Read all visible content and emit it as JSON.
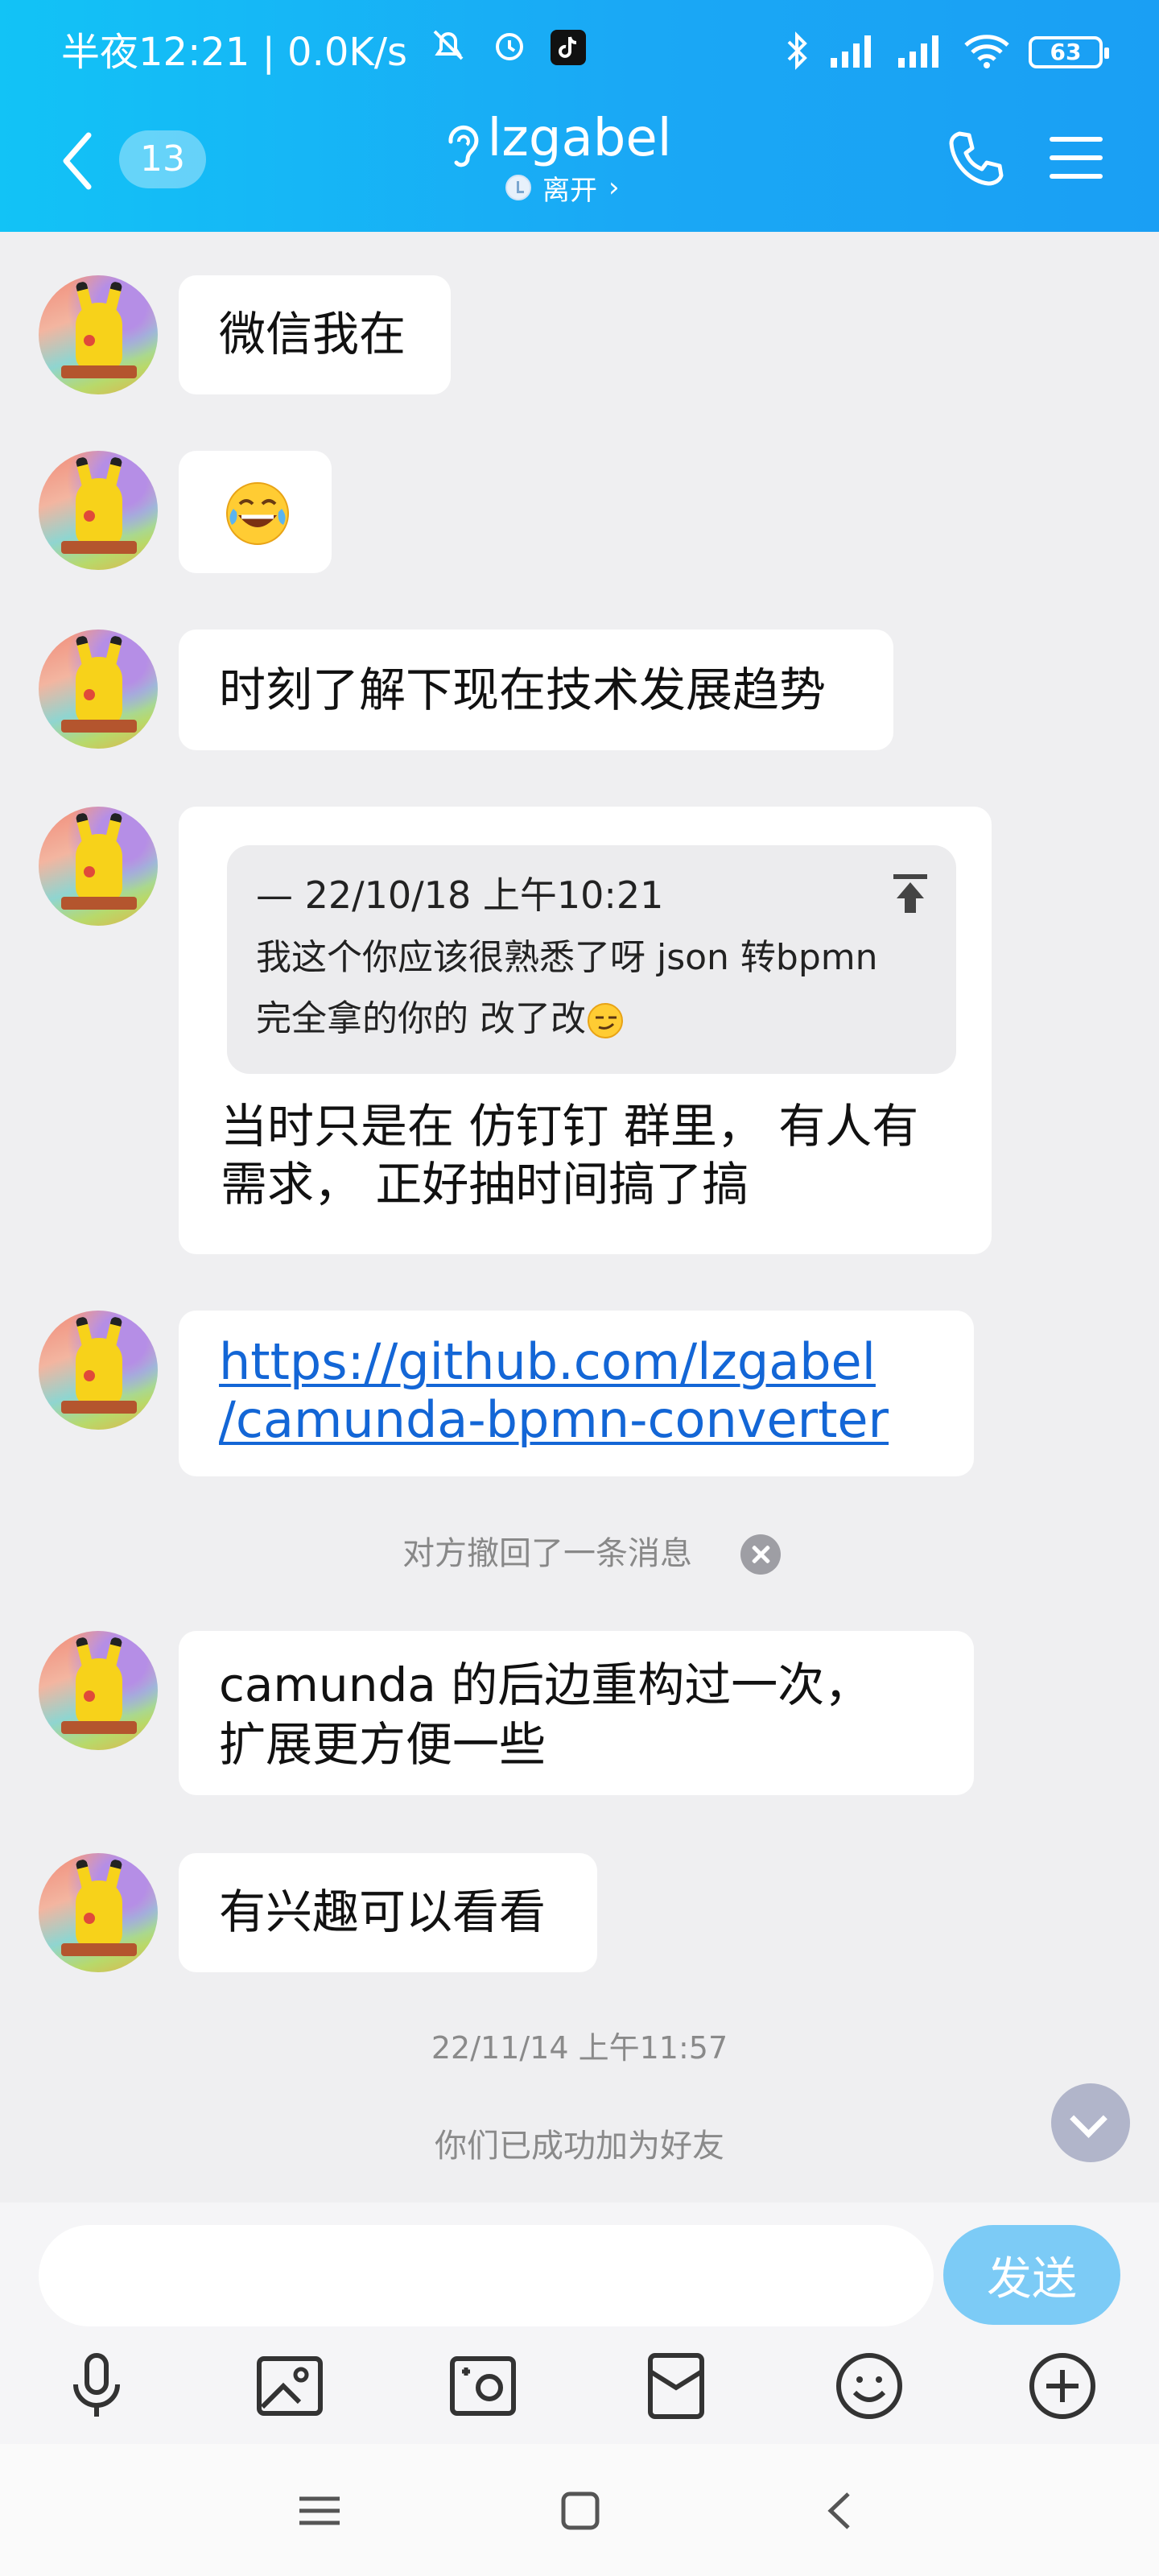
{
  "status_bar": {
    "time": "半夜12:21",
    "network_speed": "0.0K/s",
    "battery": "63",
    "icons": [
      "mute-icon",
      "alarm-icon",
      "tiktok-icon",
      "bluetooth-icon",
      "signal-icon",
      "signal-icon",
      "wifi-icon",
      "battery-icon"
    ]
  },
  "header": {
    "unread_count": "13",
    "contact_name": "lzgabel",
    "presence": "离开",
    "accent_color": "#1aa8f5"
  },
  "messages": [
    {
      "type": "text",
      "text": "微信我在"
    },
    {
      "type": "emoji",
      "emoji": "laughing-tears-emoji"
    },
    {
      "type": "text",
      "text": "时刻了解下现在技术发展趋势"
    },
    {
      "type": "reply",
      "quote": {
        "meta": "— 22/10/18 上午10:21",
        "line1": "我这个你应该很熟悉了呀 json 转bpmn",
        "line2": "完全拿的你的  改了改"
      },
      "line1": "当时只是在 仿钉钉 群里， 有人有",
      "line2": "需求， 正好抽时间搞了搞"
    },
    {
      "type": "link",
      "line1": "https://github.com/lzgabel",
      "line2": "/camunda-bpmn-converter"
    },
    {
      "type": "text",
      "line1": "camunda 的后边重构过一次，",
      "line2": "扩展更方便一些"
    },
    {
      "type": "text",
      "text": "有兴趣可以看看"
    }
  ],
  "system": {
    "recalled": "对方撤回了一条消息",
    "timestamp": "22/11/14 上午11:57",
    "friend_added": "你们已成功加为好友"
  },
  "composer": {
    "input_value": "",
    "send_label": "发送",
    "toolbar_icons": [
      "microphone-icon",
      "image-icon",
      "camera-icon",
      "red-packet-icon",
      "emoji-icon",
      "plus-icon"
    ]
  },
  "nav": {
    "icons": [
      "menu-icon",
      "home-icon",
      "back-icon"
    ]
  }
}
